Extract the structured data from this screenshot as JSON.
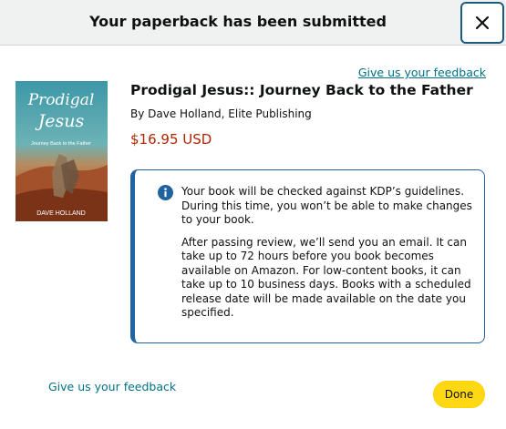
{
  "header": {
    "title": "Your paperback has been submitted"
  },
  "close_icon": "close-icon",
  "feedback": {
    "top_label": "Give us your feedback",
    "bottom_label": "Give us your feedback"
  },
  "book": {
    "title": "Prodigal Jesus:: Journey Back to the Father",
    "byline": "By Dave Holland, Elite Publishing",
    "price": "$16.95 USD",
    "cover": {
      "title_line1": "Prodigal",
      "title_line2": "Jesus",
      "subtitle": "Journey Back to the Father",
      "author": "DAVE HOLLAND"
    }
  },
  "info": {
    "icon": "info-icon",
    "paragraph1": "Your book will be checked against KDP’s guidelines. During this time, you won’t be able to make changes to your book.",
    "paragraph2": "After passing review, we’ll send you an email. It can take up to 72 hours before you book becomes available on Amazon. For low-content books, it can take up to 10 business days. Books with a scheduled release date will be made available on the date you specified."
  },
  "actions": {
    "done_label": "Done"
  },
  "colors": {
    "accent": "#2162a1",
    "link": "#007185",
    "price": "#b12704",
    "done_bg": "#ffd814"
  }
}
